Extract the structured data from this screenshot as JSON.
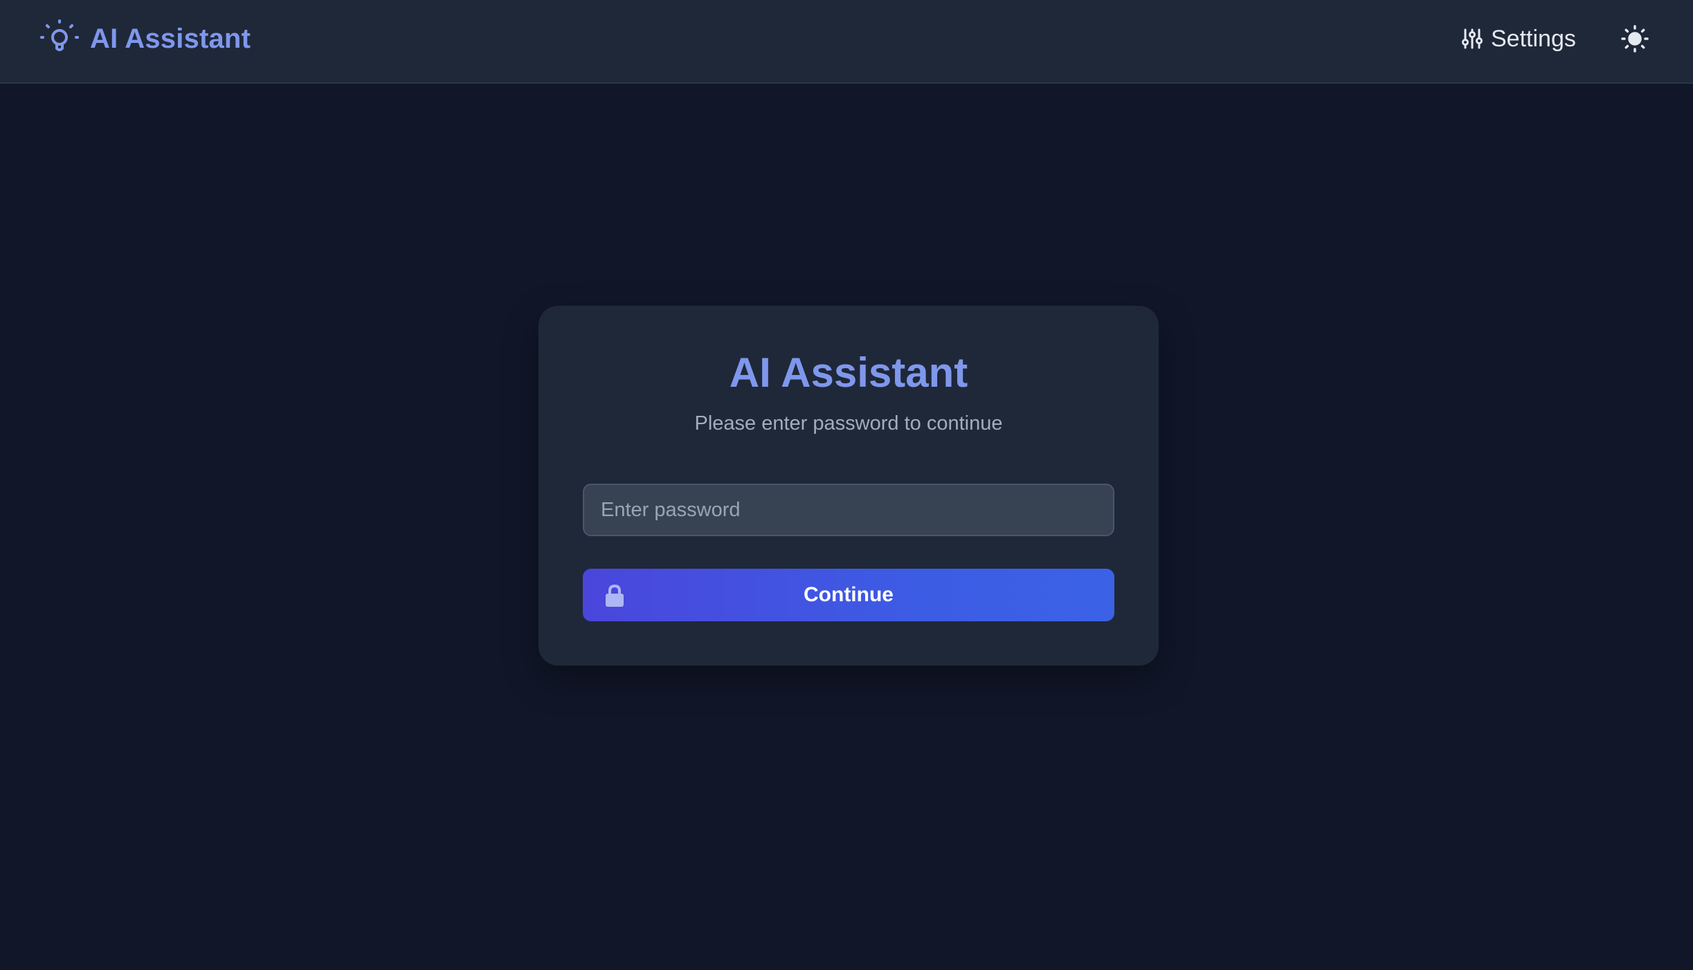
{
  "header": {
    "brand_icon": "lightbulb-icon",
    "brand_title": "AI Assistant",
    "settings_icon": "sliders-icon",
    "settings_label": "Settings",
    "theme_toggle_icon": "sun-icon"
  },
  "login_card": {
    "title": "AI Assistant",
    "subtitle": "Please enter password to continue",
    "password_input": {
      "value": "",
      "placeholder": "Enter password"
    },
    "continue_button": {
      "icon": "lock-icon",
      "label": "Continue"
    }
  },
  "colors": {
    "page_background": "#111729",
    "surface": "#1f2839",
    "accent": "#7f97ec",
    "button_gradient_start": "#4a46dc",
    "button_gradient_end": "#3b62e6",
    "input_background": "#374253"
  }
}
